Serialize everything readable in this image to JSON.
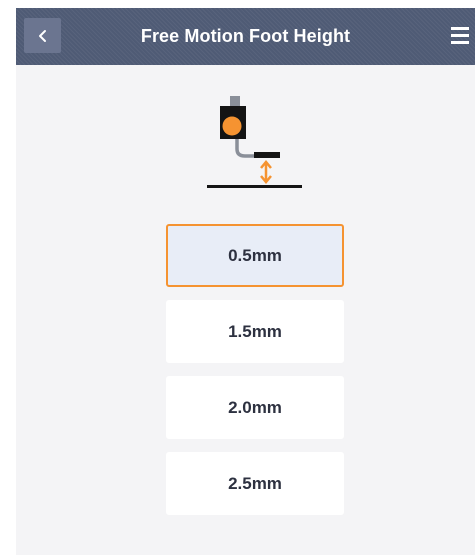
{
  "header": {
    "title": "Free Motion Foot Height",
    "back_icon": "chevron-left-icon",
    "menu_icon": "hamburger-menu-icon"
  },
  "illustration": {
    "icon": "presser-foot-height-icon",
    "accent_color": "#f59331"
  },
  "options": [
    {
      "label": "0.5mm",
      "selected": true
    },
    {
      "label": "1.5mm",
      "selected": false
    },
    {
      "label": "2.0mm",
      "selected": false
    },
    {
      "label": "2.5mm",
      "selected": false
    }
  ],
  "colors": {
    "header_bg": "#4f5b75",
    "selected_border": "#f59331",
    "selected_bg": "#e8edf7",
    "screen_bg": "#f4f4f6"
  }
}
